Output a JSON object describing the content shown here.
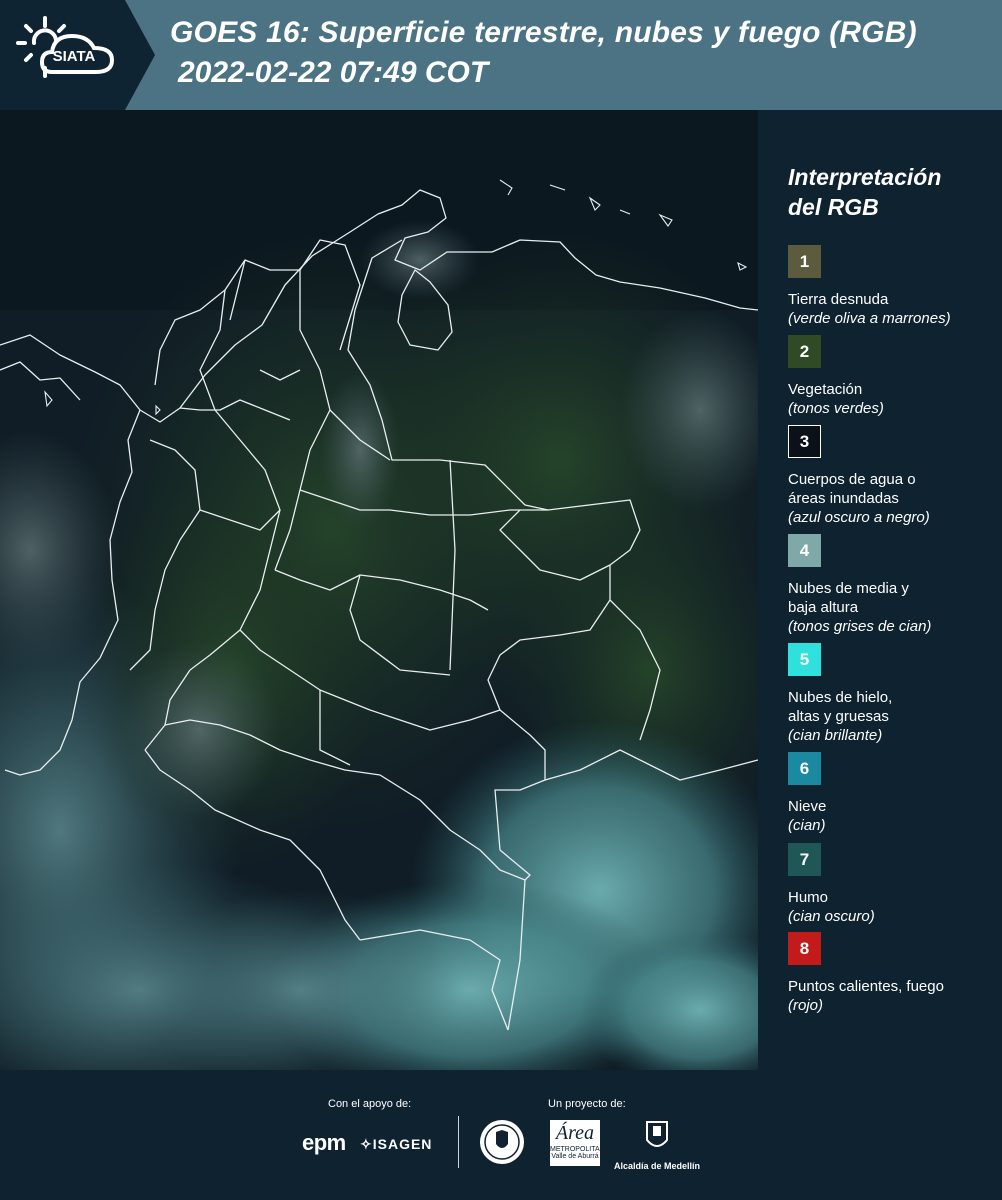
{
  "header": {
    "logo_text": "SIATA",
    "title_line1": "GOES 16: Superficie terrestre, nubes y fuego (RGB)",
    "title_line2": "2022-02-22 07:49 COT"
  },
  "legend": {
    "title_line1": "Interpretación",
    "title_line2": "del RGB",
    "items": [
      {
        "number": "1",
        "label": "Tierra desnuda",
        "sub": "(verde oliva a marrones)",
        "color": "#5c5b3e",
        "border": "#5c5b3e"
      },
      {
        "number": "2",
        "label": "Vegetación",
        "sub": "(tonos verdes)",
        "color": "#2f4a24",
        "border": "#2f4a24"
      },
      {
        "number": "3",
        "label": "Cuerpos de agua o áreas inundadas",
        "sub": "(azul oscuro a negro)",
        "color": "#0b1118",
        "border": "#ffffff"
      },
      {
        "number": "4",
        "label": "Nubes de media y baja altura",
        "sub": "(tonos grises de cian)",
        "color": "#7fa9a9",
        "border": "#7fa9a9"
      },
      {
        "number": "5",
        "label": "Nubes de hielo, altas y gruesas",
        "sub": "(cian brillante)",
        "color": "#2fe0dc",
        "border": "#2fe0dc"
      },
      {
        "number": "6",
        "label": "Nieve",
        "sub": "(cian)",
        "color": "#1b8aa0",
        "border": "#1b8aa0"
      },
      {
        "number": "7",
        "label": "Humo",
        "sub": "(cian oscuro)",
        "color": "#1f5656",
        "border": "#1f5656"
      },
      {
        "number": "8",
        "label": "Puntos calientes, fuego",
        "sub": "(rojo)",
        "color": "#c31b1b",
        "border": "#c31b1b"
      }
    ]
  },
  "footer": {
    "support_label": "Con el apoyo de:",
    "project_label": "Un proyecto de:",
    "epm": "epm",
    "isagen": "ISAGEN",
    "area_big": "Área",
    "area_small": "METROPOLITANA",
    "area_small2": "Valle de Aburrá",
    "medellin": "Alcaldía de Medellín"
  }
}
